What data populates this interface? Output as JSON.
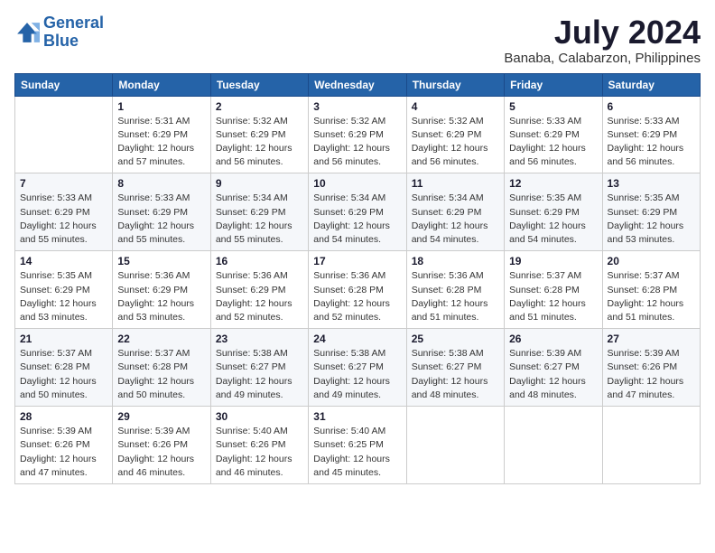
{
  "header": {
    "logo_line1": "General",
    "logo_line2": "Blue",
    "month": "July 2024",
    "location": "Banaba, Calabarzon, Philippines"
  },
  "days_of_week": [
    "Sunday",
    "Monday",
    "Tuesday",
    "Wednesday",
    "Thursday",
    "Friday",
    "Saturday"
  ],
  "weeks": [
    [
      {
        "day": "",
        "info": ""
      },
      {
        "day": "1",
        "info": "Sunrise: 5:31 AM\nSunset: 6:29 PM\nDaylight: 12 hours\nand 57 minutes."
      },
      {
        "day": "2",
        "info": "Sunrise: 5:32 AM\nSunset: 6:29 PM\nDaylight: 12 hours\nand 56 minutes."
      },
      {
        "day": "3",
        "info": "Sunrise: 5:32 AM\nSunset: 6:29 PM\nDaylight: 12 hours\nand 56 minutes."
      },
      {
        "day": "4",
        "info": "Sunrise: 5:32 AM\nSunset: 6:29 PM\nDaylight: 12 hours\nand 56 minutes."
      },
      {
        "day": "5",
        "info": "Sunrise: 5:33 AM\nSunset: 6:29 PM\nDaylight: 12 hours\nand 56 minutes."
      },
      {
        "day": "6",
        "info": "Sunrise: 5:33 AM\nSunset: 6:29 PM\nDaylight: 12 hours\nand 56 minutes."
      }
    ],
    [
      {
        "day": "7",
        "info": "Sunrise: 5:33 AM\nSunset: 6:29 PM\nDaylight: 12 hours\nand 55 minutes."
      },
      {
        "day": "8",
        "info": "Sunrise: 5:33 AM\nSunset: 6:29 PM\nDaylight: 12 hours\nand 55 minutes."
      },
      {
        "day": "9",
        "info": "Sunrise: 5:34 AM\nSunset: 6:29 PM\nDaylight: 12 hours\nand 55 minutes."
      },
      {
        "day": "10",
        "info": "Sunrise: 5:34 AM\nSunset: 6:29 PM\nDaylight: 12 hours\nand 54 minutes."
      },
      {
        "day": "11",
        "info": "Sunrise: 5:34 AM\nSunset: 6:29 PM\nDaylight: 12 hours\nand 54 minutes."
      },
      {
        "day": "12",
        "info": "Sunrise: 5:35 AM\nSunset: 6:29 PM\nDaylight: 12 hours\nand 54 minutes."
      },
      {
        "day": "13",
        "info": "Sunrise: 5:35 AM\nSunset: 6:29 PM\nDaylight: 12 hours\nand 53 minutes."
      }
    ],
    [
      {
        "day": "14",
        "info": "Sunrise: 5:35 AM\nSunset: 6:29 PM\nDaylight: 12 hours\nand 53 minutes."
      },
      {
        "day": "15",
        "info": "Sunrise: 5:36 AM\nSunset: 6:29 PM\nDaylight: 12 hours\nand 53 minutes."
      },
      {
        "day": "16",
        "info": "Sunrise: 5:36 AM\nSunset: 6:29 PM\nDaylight: 12 hours\nand 52 minutes."
      },
      {
        "day": "17",
        "info": "Sunrise: 5:36 AM\nSunset: 6:28 PM\nDaylight: 12 hours\nand 52 minutes."
      },
      {
        "day": "18",
        "info": "Sunrise: 5:36 AM\nSunset: 6:28 PM\nDaylight: 12 hours\nand 51 minutes."
      },
      {
        "day": "19",
        "info": "Sunrise: 5:37 AM\nSunset: 6:28 PM\nDaylight: 12 hours\nand 51 minutes."
      },
      {
        "day": "20",
        "info": "Sunrise: 5:37 AM\nSunset: 6:28 PM\nDaylight: 12 hours\nand 51 minutes."
      }
    ],
    [
      {
        "day": "21",
        "info": "Sunrise: 5:37 AM\nSunset: 6:28 PM\nDaylight: 12 hours\nand 50 minutes."
      },
      {
        "day": "22",
        "info": "Sunrise: 5:37 AM\nSunset: 6:28 PM\nDaylight: 12 hours\nand 50 minutes."
      },
      {
        "day": "23",
        "info": "Sunrise: 5:38 AM\nSunset: 6:27 PM\nDaylight: 12 hours\nand 49 minutes."
      },
      {
        "day": "24",
        "info": "Sunrise: 5:38 AM\nSunset: 6:27 PM\nDaylight: 12 hours\nand 49 minutes."
      },
      {
        "day": "25",
        "info": "Sunrise: 5:38 AM\nSunset: 6:27 PM\nDaylight: 12 hours\nand 48 minutes."
      },
      {
        "day": "26",
        "info": "Sunrise: 5:39 AM\nSunset: 6:27 PM\nDaylight: 12 hours\nand 48 minutes."
      },
      {
        "day": "27",
        "info": "Sunrise: 5:39 AM\nSunset: 6:26 PM\nDaylight: 12 hours\nand 47 minutes."
      }
    ],
    [
      {
        "day": "28",
        "info": "Sunrise: 5:39 AM\nSunset: 6:26 PM\nDaylight: 12 hours\nand 47 minutes."
      },
      {
        "day": "29",
        "info": "Sunrise: 5:39 AM\nSunset: 6:26 PM\nDaylight: 12 hours\nand 46 minutes."
      },
      {
        "day": "30",
        "info": "Sunrise: 5:40 AM\nSunset: 6:26 PM\nDaylight: 12 hours\nand 46 minutes."
      },
      {
        "day": "31",
        "info": "Sunrise: 5:40 AM\nSunset: 6:25 PM\nDaylight: 12 hours\nand 45 minutes."
      },
      {
        "day": "",
        "info": ""
      },
      {
        "day": "",
        "info": ""
      },
      {
        "day": "",
        "info": ""
      }
    ]
  ]
}
